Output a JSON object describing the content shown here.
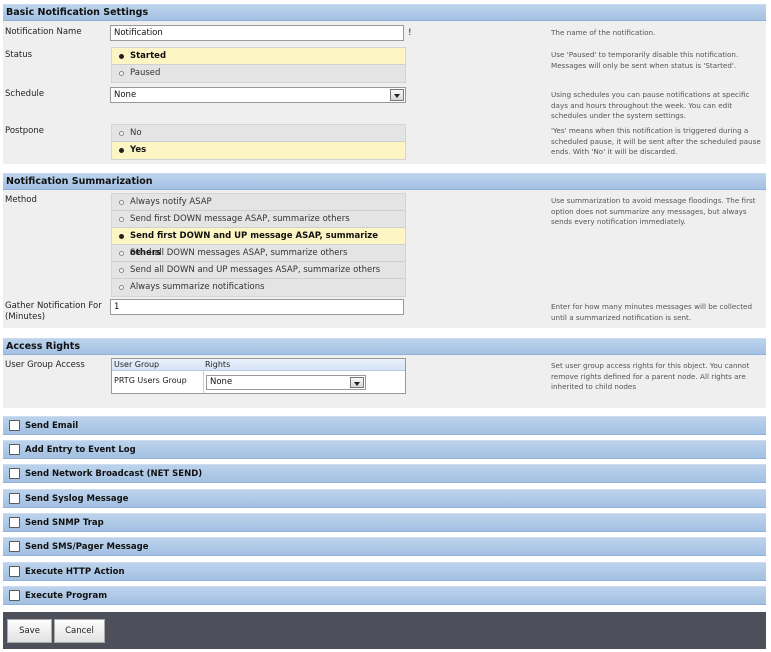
{
  "basic": {
    "title": "Basic Notification Settings",
    "name_label": "Notification Name",
    "name_value": "Notification",
    "name_required_mark": "!",
    "name_help": "The name of the notification.",
    "status_label": "Status",
    "status_options": [
      "Started",
      "Paused"
    ],
    "status_selected": "Started",
    "status_help": "Use 'Paused' to temporarily disable this notification. Messages will only be sent when status is 'Started'.",
    "schedule_label": "Schedule",
    "schedule_value": "None",
    "schedule_help": "Using schedules you can pause notifications at specific days and hours throughout the week. You can edit schedules under the system settings.",
    "postpone_label": "Postpone",
    "postpone_options": [
      "No",
      "Yes"
    ],
    "postpone_selected": "Yes",
    "postpone_help": "'Yes' means when this notification is triggered during a scheduled pause, it will be sent after the scheduled pause ends. With 'No' it will be discarded."
  },
  "summarization": {
    "title": "Notification Summarization",
    "method_label": "Method",
    "method_options": [
      "Always notify ASAP",
      "Send first DOWN message ASAP, summarize others",
      "Send first DOWN and UP message ASAP, summarize others",
      "Send all DOWN messages ASAP, summarize others",
      "Send all DOWN and UP messages ASAP, summarize others",
      "Always summarize notifications"
    ],
    "method_selected": "Send first DOWN and UP message ASAP, summarize others",
    "method_help": "Use summarization to avoid message floodings. The first option does not summarize any messages, but always sends every notification immediately.",
    "gather_label": "Gather Notification For (Minutes)",
    "gather_value": "1",
    "gather_help": "Enter for how many minutes messages will be collected until a summarized notification is sent."
  },
  "access": {
    "title": "Access Rights",
    "label": "User Group Access",
    "col_group": "User Group",
    "col_rights": "Rights",
    "row_group": "PRTG Users Group",
    "row_rights": "None",
    "help": "Set user group access rights for this object. You cannot remove rights defined for a parent node. All rights are inherited to child nodes"
  },
  "actions": [
    "Send Email",
    "Add Entry to Event Log",
    "Send Network Broadcast (NET SEND)",
    "Send Syslog Message",
    "Send SNMP Trap",
    "Send SMS/Pager Message",
    "Execute HTTP Action",
    "Execute Program"
  ],
  "footer": {
    "save_label": "Save",
    "cancel_label": "Cancel"
  }
}
